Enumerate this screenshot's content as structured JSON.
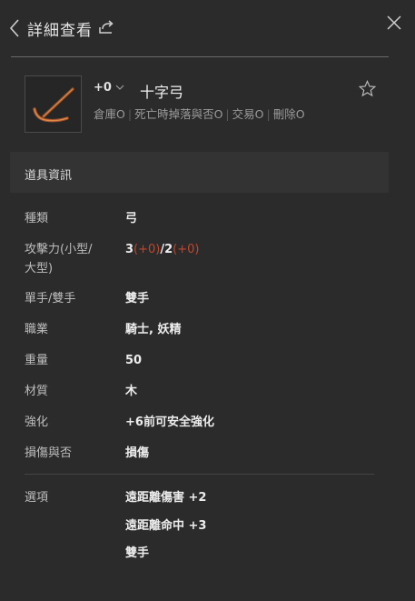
{
  "header": {
    "title": "詳細查看",
    "back_icon": "chevron-left-icon",
    "share_icon": "share-icon",
    "close_icon": "close-icon"
  },
  "item": {
    "enhance": "+0",
    "name": "十字弓",
    "flags": [
      "倉庫O",
      "死亡時掉落與否O",
      "交易O",
      "刪除O"
    ]
  },
  "section": {
    "title": "道具資訊"
  },
  "props": {
    "type": {
      "label": "種類",
      "value": "弓"
    },
    "attack": {
      "label_line1": "攻擊力(小型/",
      "label_line2": "大型)",
      "small": "3",
      "small_bonus": "(+0)",
      "slash": "/",
      "large": "2",
      "large_bonus": "(+0)"
    },
    "hands": {
      "label": "單手/雙手",
      "value": "雙手"
    },
    "classes": {
      "label": "職業",
      "value": "騎士, 妖精"
    },
    "weight": {
      "label": "重量",
      "value": "50"
    },
    "material": {
      "label": "材質",
      "value": "木"
    },
    "enchant": {
      "label": "強化",
      "value": "+6前可安全強化"
    },
    "damage": {
      "label": "損傷與否",
      "value": "損傷"
    },
    "options": {
      "label": "選項",
      "values": [
        "遠距離傷害 +2",
        "遠距離命中 +3",
        "雙手"
      ]
    }
  },
  "colors": {
    "bonus_red": "#c0462e",
    "background": "#2b2b2b"
  }
}
